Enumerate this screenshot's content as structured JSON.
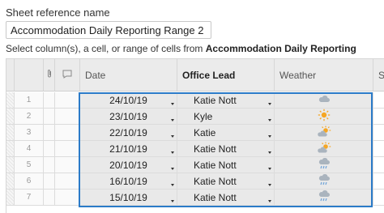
{
  "sheet_reference": {
    "label": "Sheet reference name",
    "value": "Accommodation Daily Reporting Range 2"
  },
  "instruction": {
    "prefix": "Select column(s), a cell, or range of cells from",
    "sheet_name": "Accommodation Daily Reporting"
  },
  "columns": {
    "attachments_icon": "paperclip-icon",
    "comments_icon": "comment-icon",
    "date": "Date",
    "office_lead": "Office Lead",
    "weather": "Weather",
    "extra": "Se"
  },
  "rows": [
    {
      "num": "1",
      "date": "24/10/19",
      "lead": "Katie Nott",
      "weather": "cloudy"
    },
    {
      "num": "2",
      "date": "23/10/19",
      "lead": "Kyle",
      "weather": "sunny"
    },
    {
      "num": "3",
      "date": "22/10/19",
      "lead": "Katie",
      "weather": "partly-sunny"
    },
    {
      "num": "4",
      "date": "21/10/19",
      "lead": "Katie Nott",
      "weather": "partly-sunny"
    },
    {
      "num": "5",
      "date": "20/10/19",
      "lead": "Katie Nott",
      "weather": "rain"
    },
    {
      "num": "6",
      "date": "16/10/19",
      "lead": "Katie Nott",
      "weather": "rain"
    },
    {
      "num": "7",
      "date": "15/10/19",
      "lead": "Katie Nott",
      "weather": "rain"
    }
  ],
  "colors": {
    "selection": "#2b7bc8",
    "sun": "#f5a623",
    "cloud": "#aab4be",
    "rain": "#6fa3d8"
  }
}
